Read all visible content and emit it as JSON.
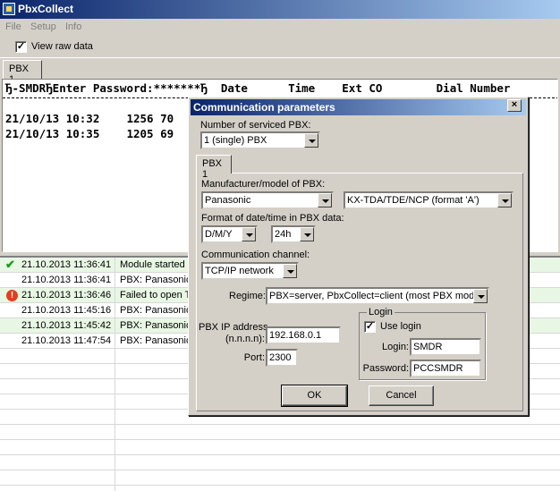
{
  "window": {
    "title": "PbxCollect"
  },
  "menu": {
    "items": [
      "File",
      "Setup",
      "Info"
    ]
  },
  "toolbar": {
    "view_raw_label": "View raw data",
    "view_raw_checked": true
  },
  "main_tab": {
    "label": "PBX 1"
  },
  "raw": {
    "header": "Ђ-SMDRЂEnter Password:*******Ђ  Date      Time    Ext CO        Dial Number",
    "lines": [
      "21/10/13 10:32    1256 70",
      "21/10/13 10:35    1205 69"
    ]
  },
  "log": {
    "rows": [
      {
        "icon": "check",
        "time": "21.10.2013 11:36:41",
        "message": "Module started"
      },
      {
        "icon": "",
        "time": "21.10.2013 11:36:41",
        "message": "PBX: Panasonic"
      },
      {
        "icon": "error",
        "time": "21.10.2013 11:36:46",
        "message": "Failed to open T"
      },
      {
        "icon": "",
        "time": "21.10.2013 11:45:16",
        "message": "PBX: Panasonic"
      },
      {
        "icon": "",
        "time": "21.10.2013 11:45:42",
        "message": "PBX: Panasonic"
      },
      {
        "icon": "",
        "time": "21.10.2013 11:47:54",
        "message": "PBX: Panasonic"
      }
    ],
    "error_glyph": "!",
    "check_glyph": "✔"
  },
  "dialog": {
    "title": "Communication parameters",
    "close_glyph": "×",
    "num_pbx_label": "Number of serviced PBX:",
    "num_pbx_value": "1 (single) PBX",
    "tab_label": "PBX 1",
    "manufacturer_label": "Manufacturer/model of PBX:",
    "manufacturer_value": "Panasonic",
    "model_value": "KX-TDA/TDE/NCP (format 'A')",
    "datetime_label": "Format of date/time in PBX data:",
    "date_format": "D/M/Y",
    "time_format": "24h",
    "channel_label": "Communication channel:",
    "channel_value": "TCP/IP network",
    "regime_label": "Regime:",
    "regime_value": "PBX=server, PbxCollect=client (most PBX models)",
    "ip_label_1": "PBX IP address",
    "ip_label_2": "(n.n.n.n):",
    "ip_value": "192.168.0.1",
    "port_label": "Port:",
    "port_value": "2300",
    "login_group_label": "Login",
    "use_login_label": "Use login",
    "use_login_checked": true,
    "login_label": "Login:",
    "login_value": "SMDR",
    "password_label": "Password:",
    "password_value": "PCCSMDR",
    "ok_label": "OK",
    "cancel_label": "Cancel"
  },
  "check_glyph": "✓"
}
